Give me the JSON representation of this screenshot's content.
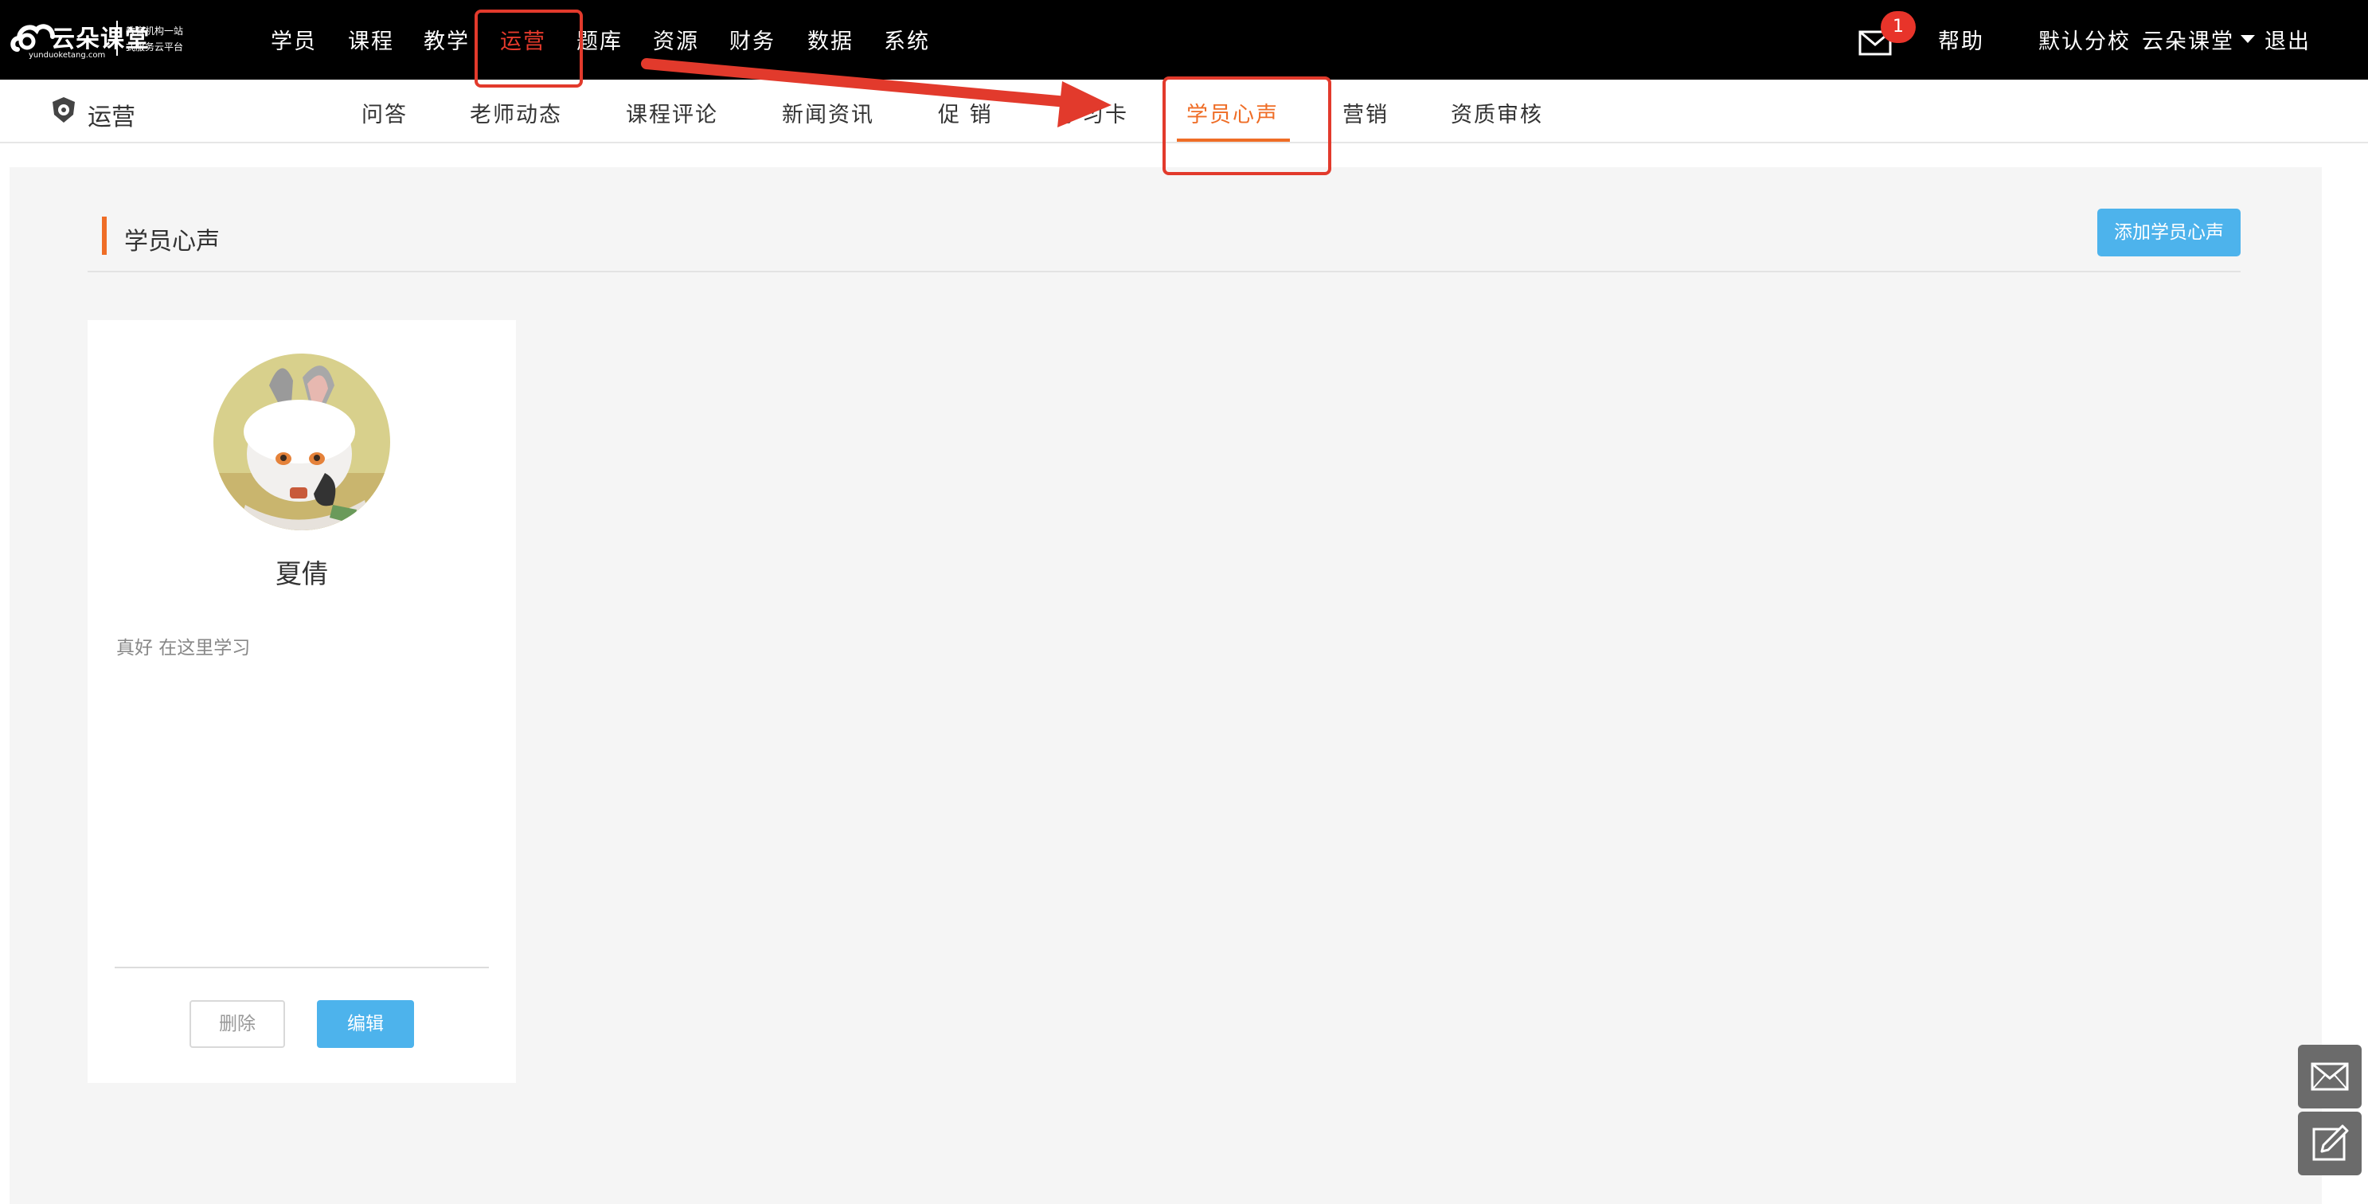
{
  "brand": {
    "name": "云朵课堂",
    "url": "yunduoketang.com",
    "slogan_line1": "教育机构一站",
    "slogan_line2": "式服务云平台"
  },
  "top_nav": {
    "items": [
      {
        "label": "学员"
      },
      {
        "label": "课程"
      },
      {
        "label": "教学"
      },
      {
        "label": "运营",
        "active": true
      },
      {
        "label": "题库"
      },
      {
        "label": "资源"
      },
      {
        "label": "财务"
      },
      {
        "label": "数据"
      },
      {
        "label": "系统"
      }
    ],
    "mail_icon": "envelope-icon",
    "mail_badge": "1",
    "help_label": "帮助",
    "campus_label": "默认分校",
    "user_label": "云朵课堂",
    "logout_label": "退出"
  },
  "sub_nav": {
    "section_title": "运营",
    "section_icon": "shield-icon",
    "items": [
      {
        "label": "问答"
      },
      {
        "label": "老师动态"
      },
      {
        "label": "课程评论"
      },
      {
        "label": "新闻资讯"
      },
      {
        "label": "促 销"
      },
      {
        "label": "学习卡"
      },
      {
        "label": "学员心声",
        "active": true
      },
      {
        "label": "营销"
      },
      {
        "label": "资质审核"
      }
    ]
  },
  "page": {
    "title": "学员心声",
    "add_button_label": "添加学员心声"
  },
  "testimonials": [
    {
      "name": "夏倩",
      "text": "真好 在这里学习",
      "delete_label": "删除",
      "edit_label": "编辑"
    }
  ],
  "floating": {
    "message_icon": "envelope-icon",
    "feedback_icon": "edit-icon"
  },
  "colors": {
    "top_bar": "#000000",
    "active_top_nav": "#e63a2c",
    "accent_orange": "#ef6d26",
    "primary_button": "#4db3ec",
    "annotation_red": "#e23a2c",
    "content_background": "#f5f5f5"
  }
}
